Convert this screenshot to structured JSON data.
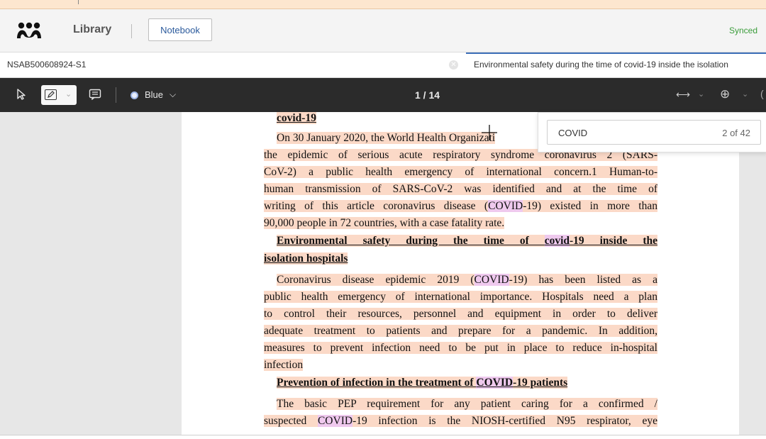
{
  "header": {
    "library_label": "Library",
    "notebook_label": "Notebook",
    "sync_status": "Synced"
  },
  "tabs": [
    {
      "label": "NSAB500608924-S1"
    },
    {
      "label": "Environmental safety during the time of covid-19 inside the isolation"
    }
  ],
  "toolbar": {
    "color_label": "Blue",
    "page_indicator": "1 / 14"
  },
  "search": {
    "term": "COVID",
    "count": "2 of 42"
  },
  "document": {
    "lines": [
      [
        "covid-19"
      ],
      [
        "On 30 January 2020, the World Health Organizati"
      ],
      [
        "the epidemic of serious acute respiratory syndrome coronavirus 2 (SARS-"
      ],
      [
        "CoV-2) a public health emergency of international concern.1 Human-to-"
      ],
      [
        "human transmission of SARS-CoV-2 was identified and at the time of"
      ],
      [
        "writing of this article coronavirus disease (",
        "COVID",
        "-19) existed in more than"
      ],
      [
        "90,000 people in 72 countries, with a case fatality rate."
      ],
      [
        "Environmental safety during the time of ",
        "covid",
        "-19 inside the"
      ],
      [
        "isolation hospitals"
      ],
      [
        "Coronavirus disease epidemic 2019 (",
        "COVID",
        "-19) has been listed as a"
      ],
      [
        "public health emergency of international importance. Hospitals need a plan"
      ],
      [
        "to control their resources, personnel and equipment in order to deliver"
      ],
      [
        "adequate treatment to patients and prepare for a pandemic. In addition,"
      ],
      [
        "measures to prevent infection need to be put in place to reduce in-hospital"
      ],
      [
        "infection"
      ],
      [
        "Prevention of infection in the treatment of ",
        "COVID",
        "-19 patients"
      ],
      [
        "The basic PEP requirement for any patient caring for a confirmed /"
      ],
      [
        "suspected ",
        "COVID",
        "-19 infection is the NIOSH-certified N95 respirator, eye"
      ]
    ]
  }
}
